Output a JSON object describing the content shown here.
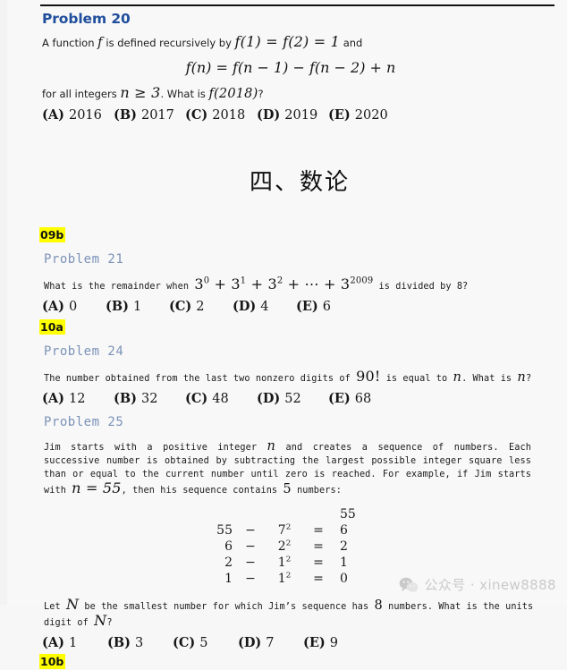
{
  "document": {
    "section_title": "四、数论"
  },
  "problems": [
    {
      "id": "p20",
      "heading": "Problem 20",
      "intro_prefix": "A function ",
      "intro_f": "f",
      "intro_mid": " is defined recursively by ",
      "intro_eq": "f(1) = f(2) = 1",
      "intro_suffix": " and",
      "display_equation": "f(n) = f(n − 1) − f(n − 2) + n",
      "tail_prefix": "for all integers ",
      "tail_cond": "n ≥ 3",
      "tail_mid": ". What is ",
      "tail_expr": "f(2018)",
      "tail_suffix": "?",
      "choices": [
        {
          "label": "(A)",
          "value": "2016"
        },
        {
          "label": "(B)",
          "value": "2017"
        },
        {
          "label": "(C)",
          "value": "2018"
        },
        {
          "label": "(D)",
          "value": "2019"
        },
        {
          "label": "(E)",
          "value": "2020"
        }
      ]
    },
    {
      "id": "p21",
      "tag": "09b",
      "heading": "Problem 21",
      "body_prefix": "What is the remainder when ",
      "body_expr": "3⁰ + 3¹ + 3² + ⋯ + 3²⁰⁰⁹",
      "body_suffix": " is divided by 8?",
      "choices": [
        {
          "label": "(A)",
          "value": "0"
        },
        {
          "label": "(B)",
          "value": "1"
        },
        {
          "label": "(C)",
          "value": "2"
        },
        {
          "label": "(D)",
          "value": "4"
        },
        {
          "label": "(E)",
          "value": "6"
        }
      ]
    },
    {
      "id": "p24",
      "tag": "10a",
      "heading": "Problem 24",
      "body_prefix": "The number obtained from the last two nonzero digits of ",
      "body_expr": "90!",
      "body_mid": " is equal to ",
      "body_var": "n",
      "body_mid2": ". What is ",
      "body_var2": "n",
      "body_suffix": "?",
      "choices": [
        {
          "label": "(A)",
          "value": "12"
        },
        {
          "label": "(B)",
          "value": "32"
        },
        {
          "label": "(C)",
          "value": "48"
        },
        {
          "label": "(D)",
          "value": "52"
        },
        {
          "label": "(E)",
          "value": "68"
        }
      ]
    },
    {
      "id": "p25",
      "heading": "Problem 25",
      "para1_a": "Jim starts with a positive integer ",
      "para1_n": "n",
      "para1_b": " and creates a sequence of numbers. Each successive number is obtained by subtracting the largest possible integer square less than or equal to the current number until zero is reached. For example, if Jim starts with ",
      "para1_eq": "n = 55",
      "para1_c": ", then his sequence contains ",
      "para1_five": "5",
      "para1_d": " numbers:",
      "sequence_table": {
        "header_value": "55",
        "rows": [
          {
            "num": "55",
            "op": "−",
            "sq_base": "7",
            "sq_exp": "2",
            "eq": "=",
            "result": "6"
          },
          {
            "num": "6",
            "op": "−",
            "sq_base": "2",
            "sq_exp": "2",
            "eq": "=",
            "result": "2"
          },
          {
            "num": "2",
            "op": "−",
            "sq_base": "1",
            "sq_exp": "2",
            "eq": "=",
            "result": "1"
          },
          {
            "num": "1",
            "op": "−",
            "sq_base": "1",
            "sq_exp": "2",
            "eq": "=",
            "result": "0"
          }
        ]
      },
      "para2_a": "Let ",
      "para2_N": "N",
      "para2_b": " be the smallest number for which Jim’s sequence has ",
      "para2_eight": "8",
      "para2_c": " numbers. What is the units digit of ",
      "para2_N2": "N",
      "para2_d": "?",
      "choices": [
        {
          "label": "(A)",
          "value": "1"
        },
        {
          "label": "(B)",
          "value": "3"
        },
        {
          "label": "(C)",
          "value": "5"
        },
        {
          "label": "(D)",
          "value": "7"
        },
        {
          "label": "(E)",
          "value": "9"
        }
      ],
      "trailing_tag": "10b"
    }
  ],
  "watermark": {
    "text": "公众号 · xinew8888",
    "icon": "wechat-icon"
  },
  "colors": {
    "heading_blue": "#1f4e9c",
    "heading_mono_blue": "#7b92b8",
    "highlight_yellow": "#ffff00",
    "page_bg": "#f8f8f8",
    "text": "#1b1b1b"
  }
}
